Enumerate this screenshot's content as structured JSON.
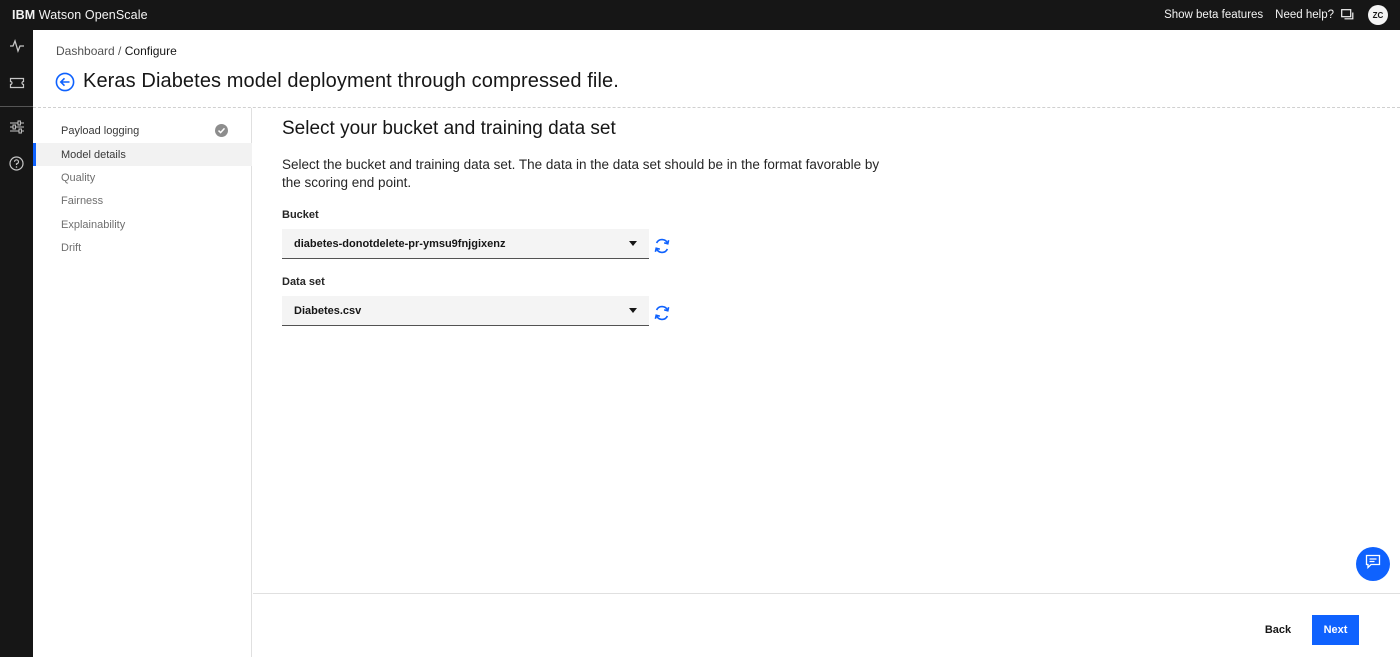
{
  "app": {
    "brand_prefix": "IBM",
    "brand_name": "Watson OpenScale"
  },
  "header": {
    "beta_link": "Show beta features",
    "help_link": "Need help?",
    "avatar_initials": "ZC"
  },
  "rail": {
    "icons": [
      "activity-icon",
      "ticket-icon",
      "settings-sliders-icon",
      "help-icon"
    ]
  },
  "page": {
    "breadcrumb": {
      "root": "Dashboard",
      "separator": " / ",
      "current": "Configure"
    },
    "title": "Keras Diabetes model deployment through compressed file."
  },
  "steps": [
    {
      "label": "Payload logging",
      "status": "done"
    },
    {
      "label": "Model details",
      "status": "active"
    },
    {
      "label": "Quality",
      "status": "pending"
    },
    {
      "label": "Fairness",
      "status": "pending"
    },
    {
      "label": "Explainability",
      "status": "pending"
    },
    {
      "label": "Drift",
      "status": "pending"
    }
  ],
  "main": {
    "title": "Select your bucket and training data set",
    "description": "Select the bucket and training data set. The data in the data set should be in the format favorable by the scoring end point.",
    "bucket": {
      "label": "Bucket",
      "value": "diabetes-donotdelete-pr-ymsu9fnjgixenz"
    },
    "dataset": {
      "label": "Data set",
      "value": "Diabetes.csv"
    }
  },
  "footer": {
    "back_label": "Back",
    "next_label": "Next"
  },
  "colors": {
    "primary": "#0f62fe",
    "header_bg": "#161616",
    "field_bg": "#f4f4f4"
  }
}
